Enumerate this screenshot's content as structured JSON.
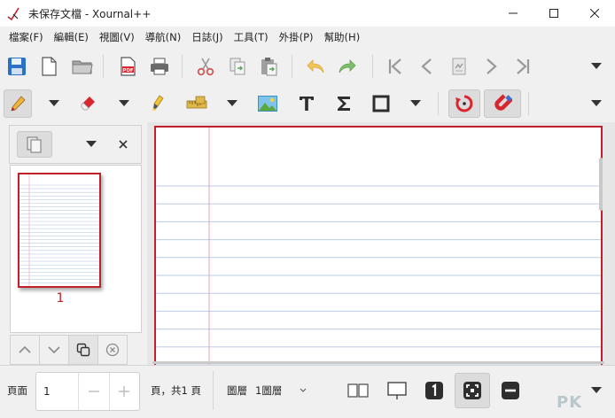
{
  "window": {
    "title": "未保存文檔 - Xournal++"
  },
  "menu": {
    "items": [
      "檔案(F)",
      "編輯(E)",
      "視圖(V)",
      "導航(N)",
      "日誌(J)",
      "工具(T)",
      "外掛(P)",
      "幫助(H)"
    ]
  },
  "colors": {
    "accent": "#c0202a",
    "rule_line": "#b9cde6",
    "margin_line": "#e8a0b4"
  },
  "icons": {
    "toolbar1": [
      "save-icon",
      "new-page-icon",
      "open-folder-icon",
      "export-pdf-icon",
      "print-icon",
      "cut-icon",
      "copy-icon",
      "paste-icon",
      "undo-icon",
      "redo-icon",
      "first-page-icon",
      "previous-page-icon",
      "goto-page-icon",
      "next-page-icon",
      "last-page-icon"
    ],
    "toolbar2": [
      "pen-icon",
      "eraser-icon",
      "highlighter-icon",
      "ruler-icon",
      "image-icon",
      "text-icon",
      "sigma-icon",
      "rectangle-icon",
      "rotation-snap-icon",
      "grid-snap-icon"
    ]
  },
  "sidebar": {
    "thumbnail_page_number": "1"
  },
  "status": {
    "page_label": "頁面",
    "page_value": "1",
    "page_total": "頁，共1 頁",
    "layer_label": "圖層",
    "layer_value": "1圖層"
  },
  "watermark": "PK"
}
